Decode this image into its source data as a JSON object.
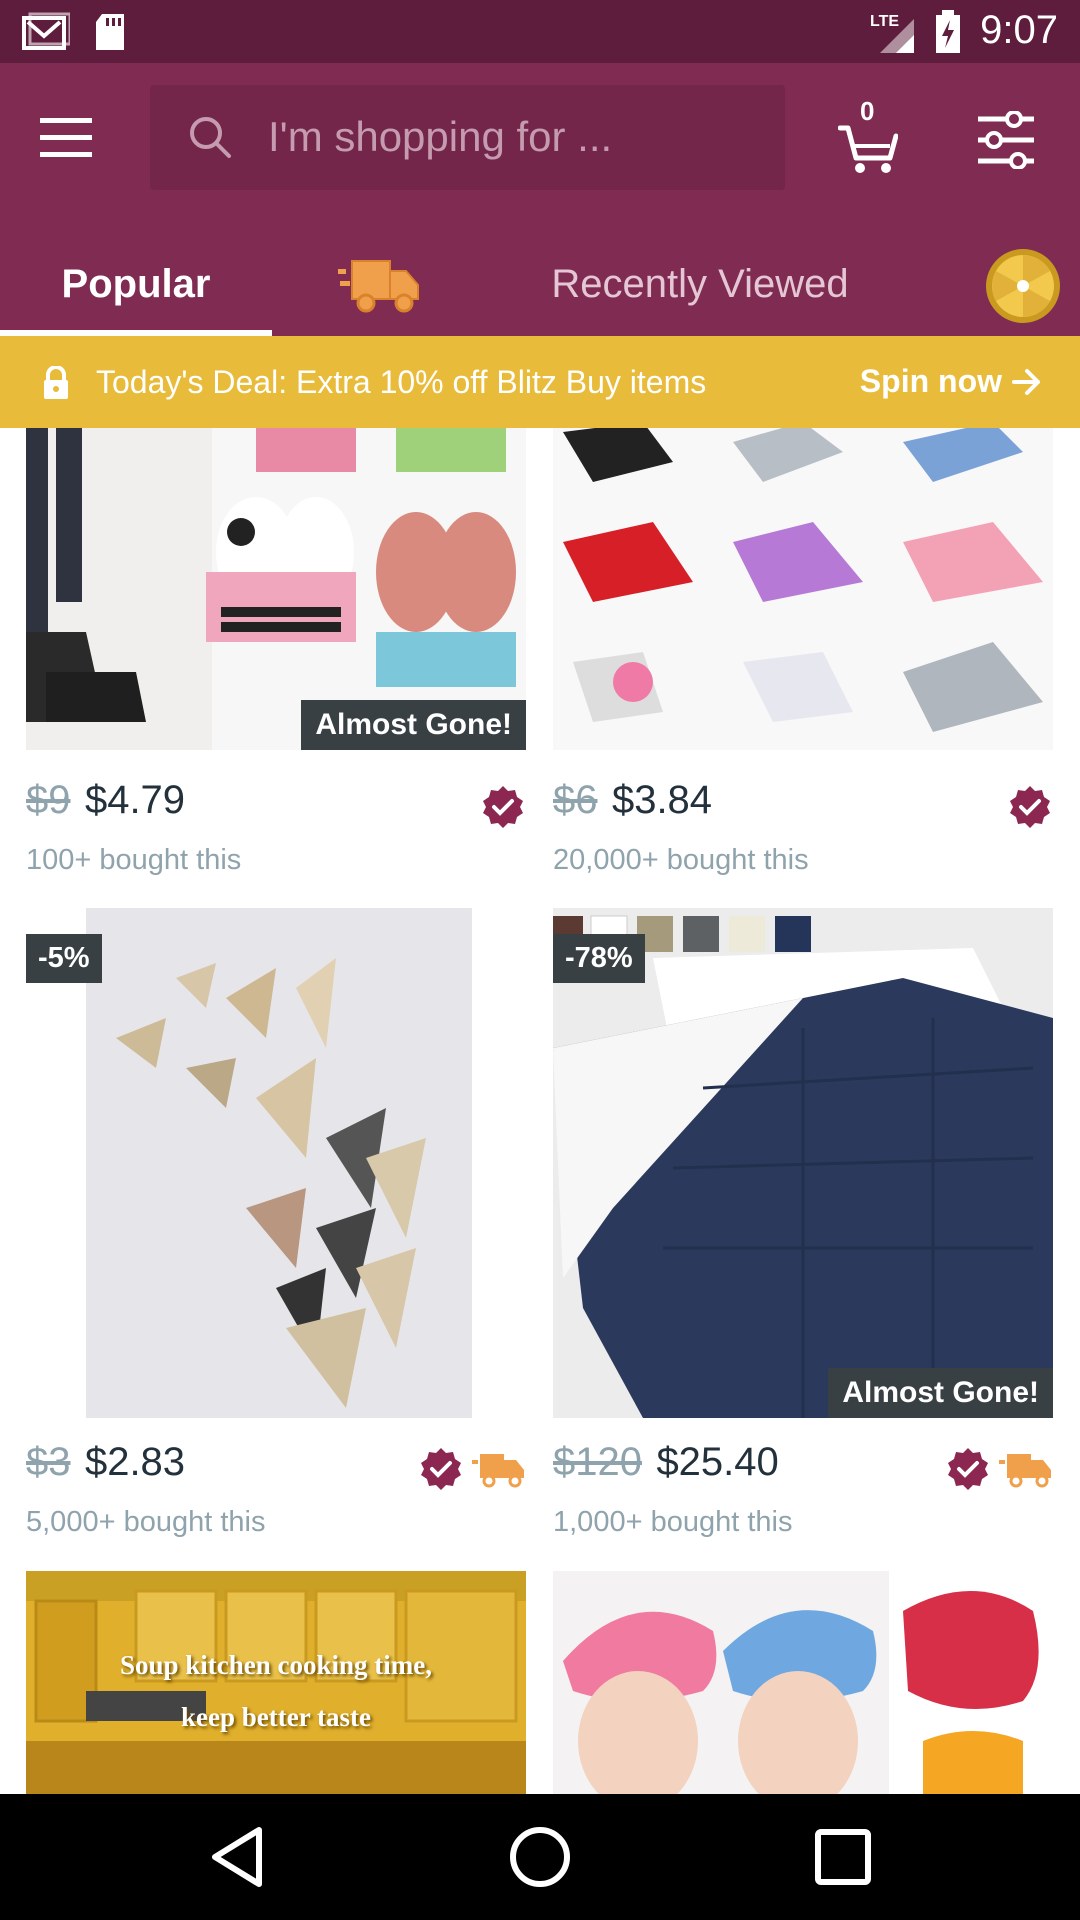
{
  "status_bar": {
    "time": "9:07",
    "network": "LTE",
    "left_icons": [
      "gmail-icon",
      "sd-card-icon"
    ],
    "right_icons": [
      "lte-signal-icon",
      "battery-charging-icon"
    ]
  },
  "header": {
    "search_placeholder": "I'm shopping for ...",
    "cart_count": "0",
    "colors": {
      "primary": "#7f2b52",
      "status_bar": "#5e1d3c",
      "accent": "#e9bb3b"
    }
  },
  "tabs": [
    {
      "label": "Popular",
      "selected": true
    },
    {
      "label": "",
      "icon": "blitz-truck-icon"
    },
    {
      "label": "Recently Viewed"
    },
    {
      "label": "",
      "icon": "spin-wheel-icon"
    }
  ],
  "deal_banner": {
    "text": "Today's Deal: Extra 10% off Blitz Buy items",
    "action": "Spin now"
  },
  "products": [
    {
      "old_price": "$9",
      "price": "$4.79",
      "bought": "100+ bought this",
      "badge": "Almost Gone!",
      "icons": [
        "verified-icon"
      ]
    },
    {
      "old_price": "$6",
      "price": "$3.84",
      "bought": "20,000+ bought this",
      "icons": [
        "verified-icon"
      ]
    },
    {
      "old_price": "$3",
      "price": "$2.83",
      "bought": "5,000+ bought this",
      "discount": "-5%",
      "icons": [
        "verified-icon",
        "fast-shipping-icon"
      ]
    },
    {
      "old_price": "$120",
      "price": "$25.40",
      "bought": "1,000+ bought this",
      "discount": "-78%",
      "badge": "Almost Gone!",
      "icons": [
        "verified-icon",
        "fast-shipping-icon"
      ]
    },
    {
      "image_caption_line1": "Soup kitchen cooking time,",
      "image_caption_line2": "keep better taste"
    },
    {}
  ],
  "nav_bar": [
    "back-icon",
    "home-icon",
    "recents-icon"
  ]
}
